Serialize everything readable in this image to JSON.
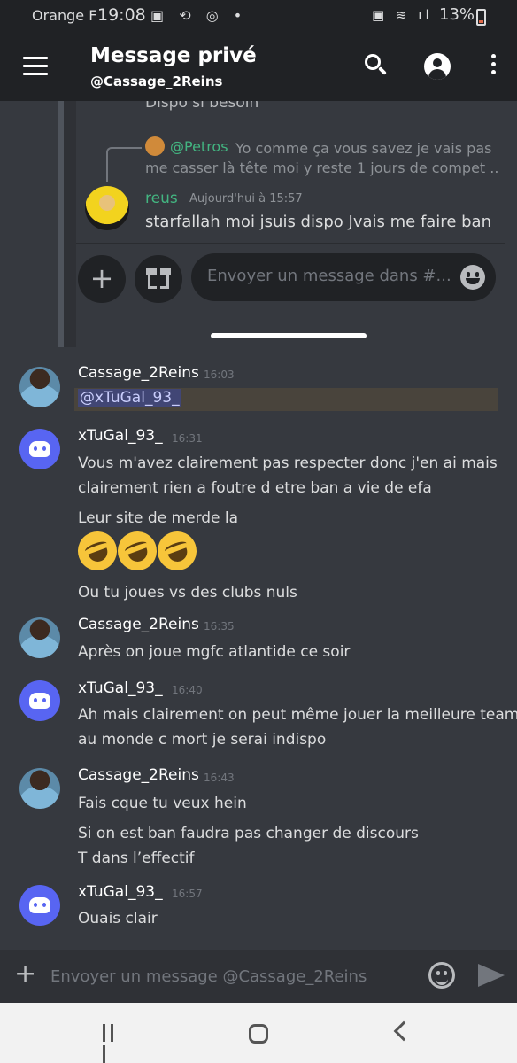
{
  "status_bar": {
    "carrier": "Orange F",
    "time": "19:08",
    "battery": "13%"
  },
  "app_bar": {
    "title": "Message privé",
    "subtitle": "@Cassage_2Reins"
  },
  "embedded_screenshot": {
    "previous_text": "Dispo si besoin",
    "reply": {
      "author": "@Petros",
      "text_line1": "Yo comme ça vous savez je vais pas",
      "text_line2": "me casser là tête moi y reste 1 jours de compet ..."
    },
    "message": {
      "author": "reus",
      "time": "Aujourd'hui à 15:57",
      "text": "starfallah moi jsuis dispo Jvais me faire ban"
    },
    "input_placeholder": "Envoyer un message dans #..."
  },
  "messages": [
    {
      "author": "Cassage_2Reins",
      "time": "16:03",
      "mention": "@xTuGal_93_"
    },
    {
      "author": "xTuGal_93_",
      "time": "16:31",
      "lines": [
        "Vous m'avez clairement pas respecter donc j'en ai mais",
        "clairement rien  a foutre d etre ban a vie de efa",
        "Leur site de merde la",
        "Ou tu joues vs des clubs nuls"
      ]
    },
    {
      "author": "Cassage_2Reins",
      "time": "16:35",
      "lines": [
        "Après on joue mgfc atlantide ce soir"
      ]
    },
    {
      "author": "xTuGal_93_",
      "time": "16:40",
      "lines": [
        "Ah mais clairement on peut même jouer la meilleure team",
        "au monde c mort je serai indispo"
      ]
    },
    {
      "author": "Cassage_2Reins",
      "time": "16:43",
      "lines": [
        "Fais cque tu veux hein",
        "Si on est ban faudra pas changer de discours",
        "T dans l’effectif"
      ]
    },
    {
      "author": "xTuGal_93_",
      "time": "16:57",
      "lines": [
        "Ouais clair"
      ]
    }
  ],
  "composer": {
    "placeholder": "Envoyer un message @Cassage_2Reins"
  },
  "icons": [
    "menu-icon",
    "search-icon",
    "profile-icon",
    "more-icon",
    "plus-icon",
    "emoji-icon",
    "send-icon",
    "gift-icon"
  ],
  "colors": {
    "background": "#36393f",
    "header": "#202225",
    "username_green": "#43b581",
    "mention": "#c9cdfb",
    "discord_blurple": "#5865f2"
  }
}
